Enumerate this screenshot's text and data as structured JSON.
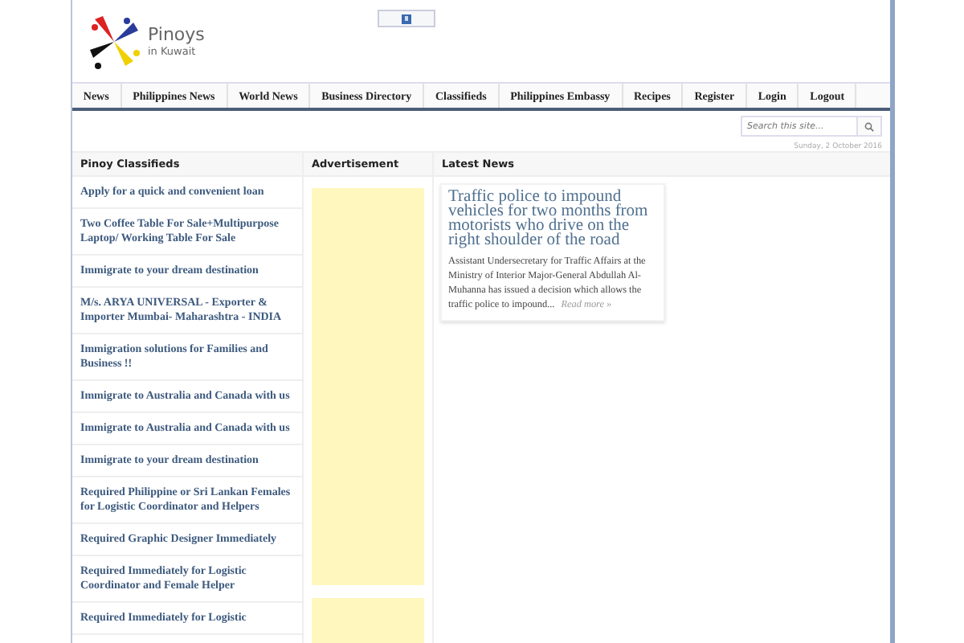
{
  "site": {
    "title": "Pinoys",
    "subtitle": "in Kuwait"
  },
  "nav": [
    {
      "label": "News"
    },
    {
      "label": "Philippines News"
    },
    {
      "label": "World News"
    },
    {
      "label": "Business Directory"
    },
    {
      "label": "Classifieds"
    },
    {
      "label": "Philippines Embassy"
    },
    {
      "label": "Recipes"
    },
    {
      "label": "Register"
    },
    {
      "label": "Login"
    },
    {
      "label": "Logout"
    }
  ],
  "search": {
    "placeholder": "Search this site..."
  },
  "date": "Sunday, 2 October 2016",
  "classifieds": {
    "heading": "Pinoy Classifieds",
    "items": [
      "Apply for a quick and convenient loan",
      "Two Coffee Table For Sale+Multipurpose Laptop/ Working Table For Sale",
      "Immigrate to your dream destination",
      "M/s. ARYA UNIVERSAL - Exporter & Importer Mumbai- Maharashtra - INDIA",
      "Immigration solutions for Families and Business !!",
      "Immigrate to Australia and Canada with us",
      "Immigrate to Australia and Canada with us",
      "Immigrate to your dream destination",
      "Required Philippine or Sri Lankan Females for Logistic Coordinator and Helpers",
      "Required Graphic Designer Immediately",
      "Required Immediately for Logistic Coordinator and Female Helper",
      "Required Immediately for Logistic"
    ]
  },
  "advertisement": {
    "heading": "Advertisement"
  },
  "latest_news": {
    "heading": "Latest News",
    "articles": [
      {
        "title": "Traffic police to impound vehicles for two months from motorists who drive on the right shoulder of the road",
        "excerpt": "Assistant Undersecretary for Traffic Affairs at the Ministry of Interior Major-General Abdullah Al-Muhanna has issued a decision which allows the traffic police to impound...",
        "read_more": "Read more »"
      }
    ]
  }
}
